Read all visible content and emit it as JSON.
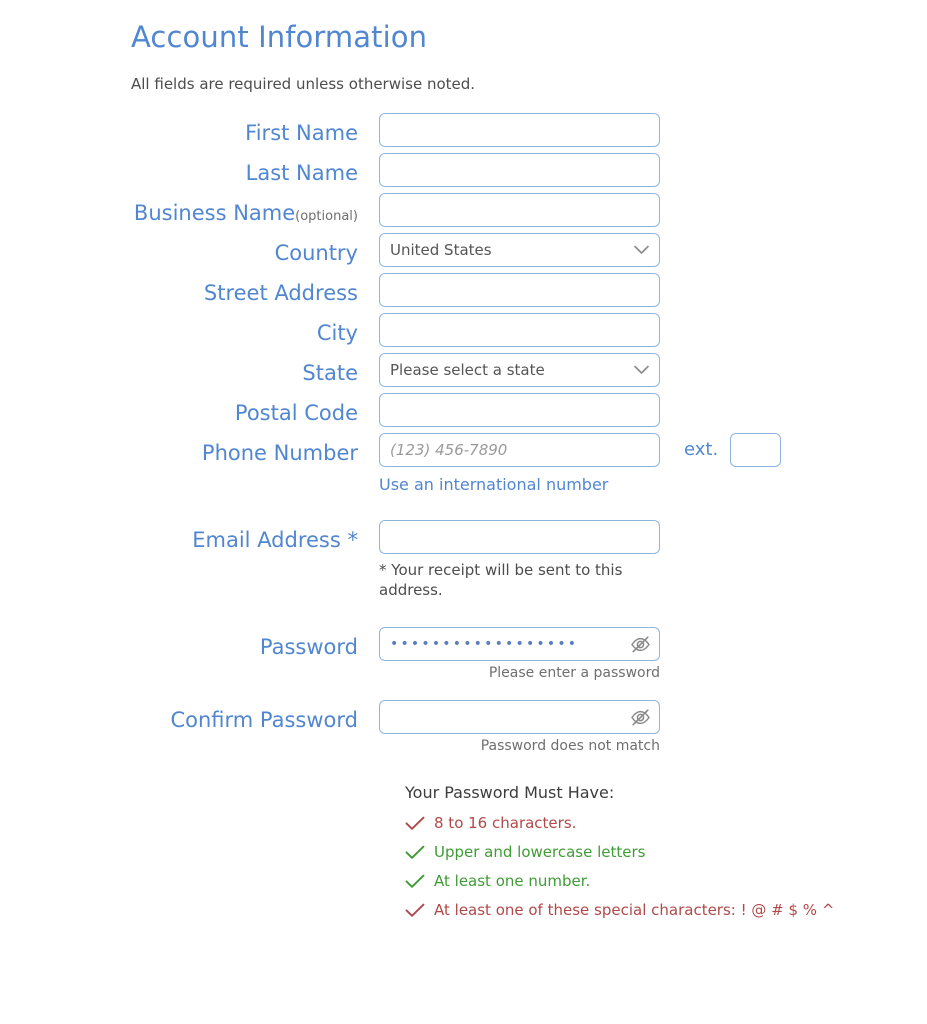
{
  "header": {
    "title": "Account Information",
    "subtitle": "All fields are required unless otherwise noted."
  },
  "colors": {
    "label_blue": "#5186d0",
    "border_blue": "#8fb4dd",
    "success_green": "#3f9c35",
    "error_red": "#b04a4a",
    "helper_gray": "#6f6f6f"
  },
  "fields": {
    "first_name": {
      "label": "First Name",
      "value": "",
      "placeholder": ""
    },
    "last_name": {
      "label": "Last Name",
      "value": "",
      "placeholder": ""
    },
    "business_name": {
      "label": "Business Name",
      "optional_note": "(optional)",
      "value": "",
      "placeholder": ""
    },
    "country": {
      "label": "Country",
      "value": "United States",
      "icon": "chevron-down-icon"
    },
    "street_address": {
      "label": "Street Address",
      "value": "",
      "placeholder": ""
    },
    "city": {
      "label": "City",
      "value": "",
      "placeholder": ""
    },
    "state": {
      "label": "State",
      "value": "Please select a state",
      "icon": "chevron-down-icon"
    },
    "postal_code": {
      "label": "Postal Code",
      "value": "",
      "placeholder": ""
    },
    "phone": {
      "label": "Phone Number",
      "value": "",
      "placeholder": "(123) 456-7890",
      "ext_label": "ext.",
      "ext_value": "",
      "international_link": "Use an international number"
    },
    "email": {
      "label": "Email Address *",
      "value": "",
      "placeholder": "",
      "note": "* Your receipt will be sent to this address."
    },
    "password": {
      "label": "Password",
      "value": "••••••••••••••••••",
      "error": "Please enter a password",
      "toggle_icon": "eye-off-icon"
    },
    "confirm_password": {
      "label": "Confirm Password",
      "value": "",
      "error": "Password does not match",
      "toggle_icon": "eye-off-icon"
    }
  },
  "password_requirements": {
    "title": "Your Password Must Have:",
    "items": [
      {
        "text": "8 to 16 characters.",
        "status": "bad",
        "icon": "check-icon"
      },
      {
        "text": "Upper and lowercase letters",
        "status": "ok",
        "icon": "check-icon"
      },
      {
        "text": "At least one number.",
        "status": "ok",
        "icon": "check-icon"
      },
      {
        "text": "At least one of these special characters: ! @ # $ % ^",
        "status": "bad",
        "icon": "check-icon"
      }
    ]
  }
}
